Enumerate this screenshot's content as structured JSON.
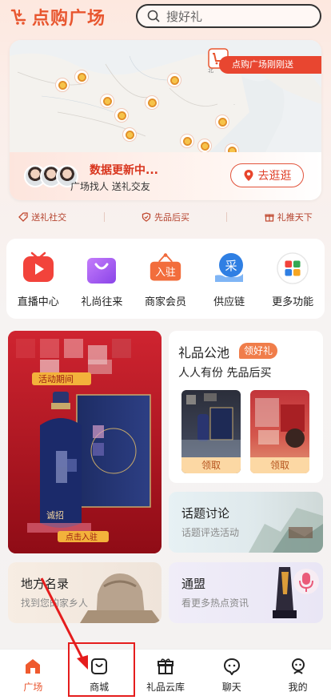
{
  "header": {
    "logo_text": "点购广场",
    "search_placeholder": "搜好礼"
  },
  "map_card": {
    "ticker_text": "点购广场刚刚送",
    "status_title": "数据更新中...",
    "subtitle": "广场找人 送礼交友",
    "go_button": "去逛逛"
  },
  "taglines": [
    {
      "label": "送礼社交",
      "icon": "tag-icon"
    },
    {
      "label": "先品后买",
      "icon": "shield-icon"
    },
    {
      "label": "礼推天下",
      "icon": "gift-icon"
    }
  ],
  "functions": [
    {
      "label": "直播中心",
      "icon": "tv-icon",
      "color": "#f2433b"
    },
    {
      "label": "礼尚往来",
      "icon": "shopping-bag-icon",
      "color": "#a15ff2"
    },
    {
      "label": "商家会员",
      "icon": "store-sign-icon",
      "color": "#f06a3b",
      "sign": "入驻"
    },
    {
      "label": "供应链",
      "icon": "supply-chain-icon",
      "color": "#2b7be0",
      "sign": "采"
    },
    {
      "label": "更多功能",
      "icon": "grid-icon",
      "color": "#34a853"
    }
  ],
  "promo": {
    "banner_text": "活动期间",
    "bottom_text": "诚招",
    "cta": "点击入驻"
  },
  "gift_pool": {
    "title": "礼品公池",
    "badge": "领好礼",
    "subtitle": "人人有份 先品后买",
    "claim_label": "领取"
  },
  "topic": {
    "title": "话题讨论",
    "subtitle": "话题评选活动"
  },
  "local": {
    "title": "地方名录",
    "subtitle": "找到您的家乡人"
  },
  "alliance": {
    "title": "通盟",
    "subtitle": "看更多热点资讯"
  },
  "nav": {
    "items": [
      {
        "label": "广场",
        "icon": "home-icon",
        "active": true
      },
      {
        "label": "商城",
        "icon": "shop-bag-icon",
        "active": false
      },
      {
        "label": "礼品云库",
        "icon": "gift-box-icon",
        "active": false
      },
      {
        "label": "聊天",
        "icon": "chat-icon",
        "active": false
      },
      {
        "label": "我的",
        "icon": "profile-icon",
        "active": false
      }
    ]
  },
  "colors": {
    "brand": "#e8562f",
    "annotation": "#e51d1d"
  }
}
